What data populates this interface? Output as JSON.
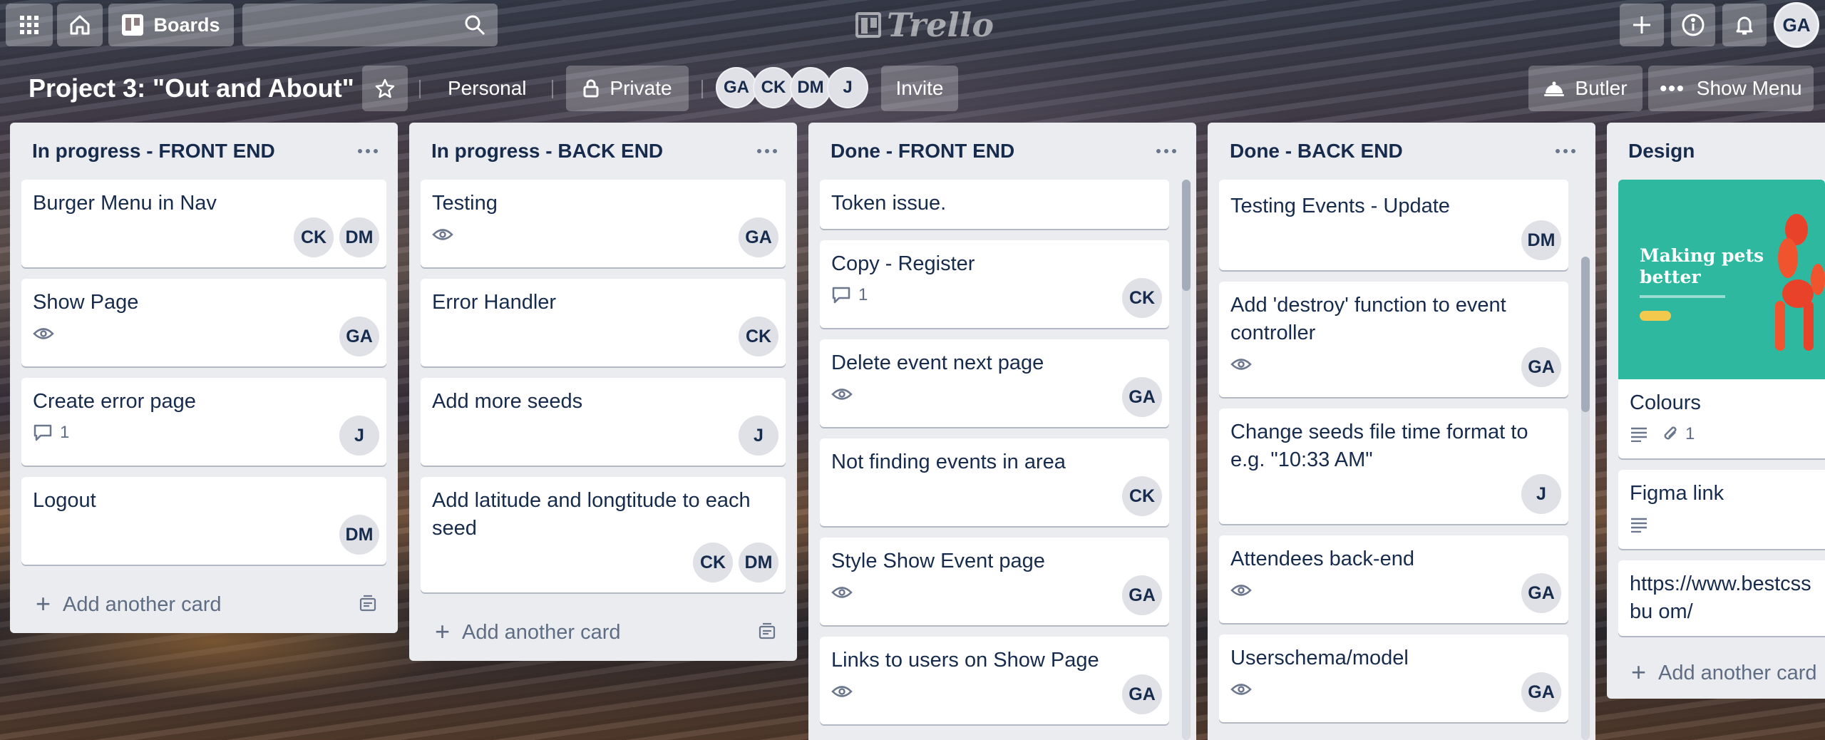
{
  "topbar": {
    "boards_label": "Boards",
    "search_placeholder": "",
    "logo_text": "Trello",
    "user_initials": "GA"
  },
  "board": {
    "title": "Project 3: \"Out and About\"",
    "personal_label": "Personal",
    "visibility_label": "Private",
    "members": [
      "GA",
      "CK",
      "DM",
      "J"
    ],
    "invite_label": "Invite",
    "butler_label": "Butler",
    "show_menu_label": "Show Menu"
  },
  "lists": [
    {
      "title": "In progress - FRONT END",
      "cards": [
        {
          "title": "Burger Menu in Nav",
          "badges": [],
          "members": [
            "CK",
            "DM"
          ]
        },
        {
          "title": "Show Page",
          "badges": [
            "watch"
          ],
          "members": [
            "GA"
          ]
        },
        {
          "title": "Create error page",
          "badges": [
            "comment"
          ],
          "comments": "1",
          "members": [
            "J"
          ]
        },
        {
          "title": "Logout",
          "badges": [],
          "members": [
            "DM"
          ]
        }
      ],
      "add_label": "Add another card"
    },
    {
      "title": "In progress - BACK END",
      "cards": [
        {
          "title": "Testing",
          "badges": [
            "watch"
          ],
          "members": [
            "GA"
          ]
        },
        {
          "title": "Error Handler",
          "badges": [],
          "members": [
            "CK"
          ]
        },
        {
          "title": "Add more seeds",
          "badges": [],
          "members": [
            "J"
          ]
        },
        {
          "title": "Add latitude and longtitude to each seed",
          "badges": [],
          "members": [
            "CK",
            "DM"
          ]
        }
      ],
      "add_label": "Add another card"
    },
    {
      "title": "Done - FRONT END",
      "cards": [
        {
          "title": "Token issue.",
          "badges": [],
          "members": []
        },
        {
          "title": "Copy - Register",
          "badges": [
            "comment"
          ],
          "comments": "1",
          "members": [
            "CK"
          ]
        },
        {
          "title": "Delete event next page",
          "badges": [
            "watch"
          ],
          "members": [
            "GA"
          ]
        },
        {
          "title": "Not finding events in area",
          "badges": [],
          "members": [
            "CK"
          ]
        },
        {
          "title": "Style Show Event page",
          "badges": [
            "watch"
          ],
          "members": [
            "GA"
          ]
        },
        {
          "title": "Links to users on Show Page",
          "badges": [
            "watch"
          ],
          "members": [
            "GA"
          ]
        }
      ]
    },
    {
      "title": "Done - BACK END",
      "cards": [
        {
          "title": "Testing Events - Update",
          "badges": [],
          "members": [
            "DM"
          ]
        },
        {
          "title": "Add 'destroy' function to event controller",
          "badges": [
            "watch"
          ],
          "members": [
            "GA"
          ]
        },
        {
          "title": "Change seeds file time format to e.g. \"10:33 AM\"",
          "badges": [],
          "members": [
            "J"
          ]
        },
        {
          "title": "Attendees back-end",
          "badges": [
            "watch"
          ],
          "members": [
            "GA"
          ]
        },
        {
          "title": "Userschema/model",
          "badges": [
            "watch"
          ],
          "members": [
            "GA"
          ]
        }
      ]
    },
    {
      "title": "Design",
      "cards": [
        {
          "title": "Colours",
          "cover": "Making pets better",
          "badges": [
            "description",
            "attachment"
          ],
          "attachments": "1",
          "members": []
        },
        {
          "title": "Figma link",
          "badges": [
            "description"
          ],
          "members": []
        },
        {
          "title": "https://www.bestcssbu om/",
          "badges": [],
          "members": []
        }
      ],
      "add_label": "Add another card"
    }
  ],
  "colors": {
    "list_bg": "#ebecf0",
    "avatar_bg": "#dfe1e6",
    "text": "#172b4d"
  }
}
